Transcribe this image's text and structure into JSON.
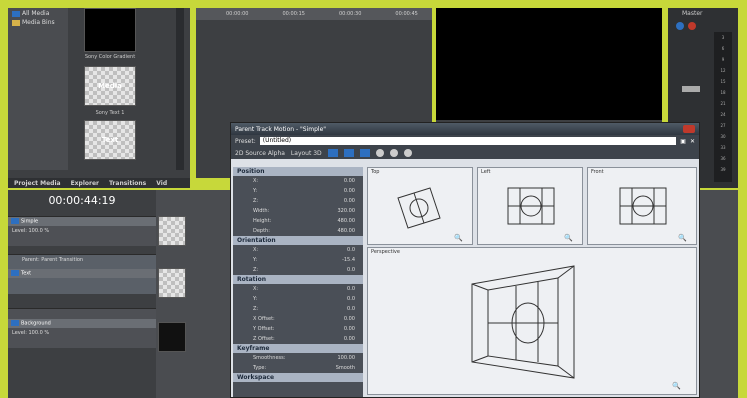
{
  "project_media": {
    "tree_items": [
      "All Media",
      "Media Bins"
    ],
    "thumbnails": [
      {
        "caption": "Sony Color Gradient",
        "overlay": ""
      },
      {
        "caption": "",
        "overlay": "Media"
      },
      {
        "caption": "Sony Text 1",
        "overlay": ""
      },
      {
        "caption": "",
        "overlay": "Text"
      }
    ],
    "tabs": [
      "Project Media",
      "Explorer",
      "Transitions",
      "Vid"
    ]
  },
  "timeline": {
    "timecode": "00:00:44:19",
    "ruler_ticks": [
      "00:00:00",
      "00:00:15",
      "00:00:30",
      "00:00:45"
    ],
    "tracks": [
      {
        "name": "Simple",
        "level": "Level: 100.0 %"
      },
      {
        "name": "Text",
        "level": "Parent: Parent Transition"
      },
      {
        "name": "Background",
        "level": "Level: 100.0 %"
      }
    ]
  },
  "mixer": {
    "title": "Master",
    "scale": [
      "3",
      "6",
      "9",
      "12",
      "15",
      "18",
      "21",
      "24",
      "27",
      "30",
      "33",
      "36",
      "39"
    ]
  },
  "dialog": {
    "title": "Parent Track Motion - \"Simple\"",
    "preset_label": "Preset:",
    "preset_value": "(Untitled)",
    "toolbar_text": "2D Source Alpha",
    "layout_text": "Layout 3D",
    "sections": [
      {
        "title": "Position",
        "rows": [
          [
            "X:",
            "0.00"
          ],
          [
            "Y:",
            "0.00"
          ],
          [
            "Z:",
            "0.00"
          ],
          [
            "Width:",
            "320.00"
          ],
          [
            "Height:",
            "480.00"
          ],
          [
            "Depth:",
            "480.00"
          ]
        ]
      },
      {
        "title": "Orientation",
        "rows": [
          [
            "X:",
            "0.0"
          ],
          [
            "Y:",
            "-15.4"
          ],
          [
            "Z:",
            "0.0"
          ]
        ]
      },
      {
        "title": "Rotation",
        "rows": [
          [
            "X:",
            "0.0"
          ],
          [
            "Y:",
            "0.0"
          ],
          [
            "Z:",
            "0.0"
          ],
          [
            "X Offset:",
            "0.00"
          ],
          [
            "Y Offset:",
            "0.00"
          ],
          [
            "Z Offset:",
            "0.00"
          ]
        ]
      },
      {
        "title": "Keyframe",
        "rows": [
          [
            "Smoothness:",
            "100.00"
          ],
          [
            "Type:",
            "Smooth"
          ]
        ]
      },
      {
        "title": "Workspace",
        "rows": []
      }
    ],
    "views": {
      "top": "Top",
      "left": "Left",
      "front": "Front",
      "perspective": "Perspective"
    }
  }
}
